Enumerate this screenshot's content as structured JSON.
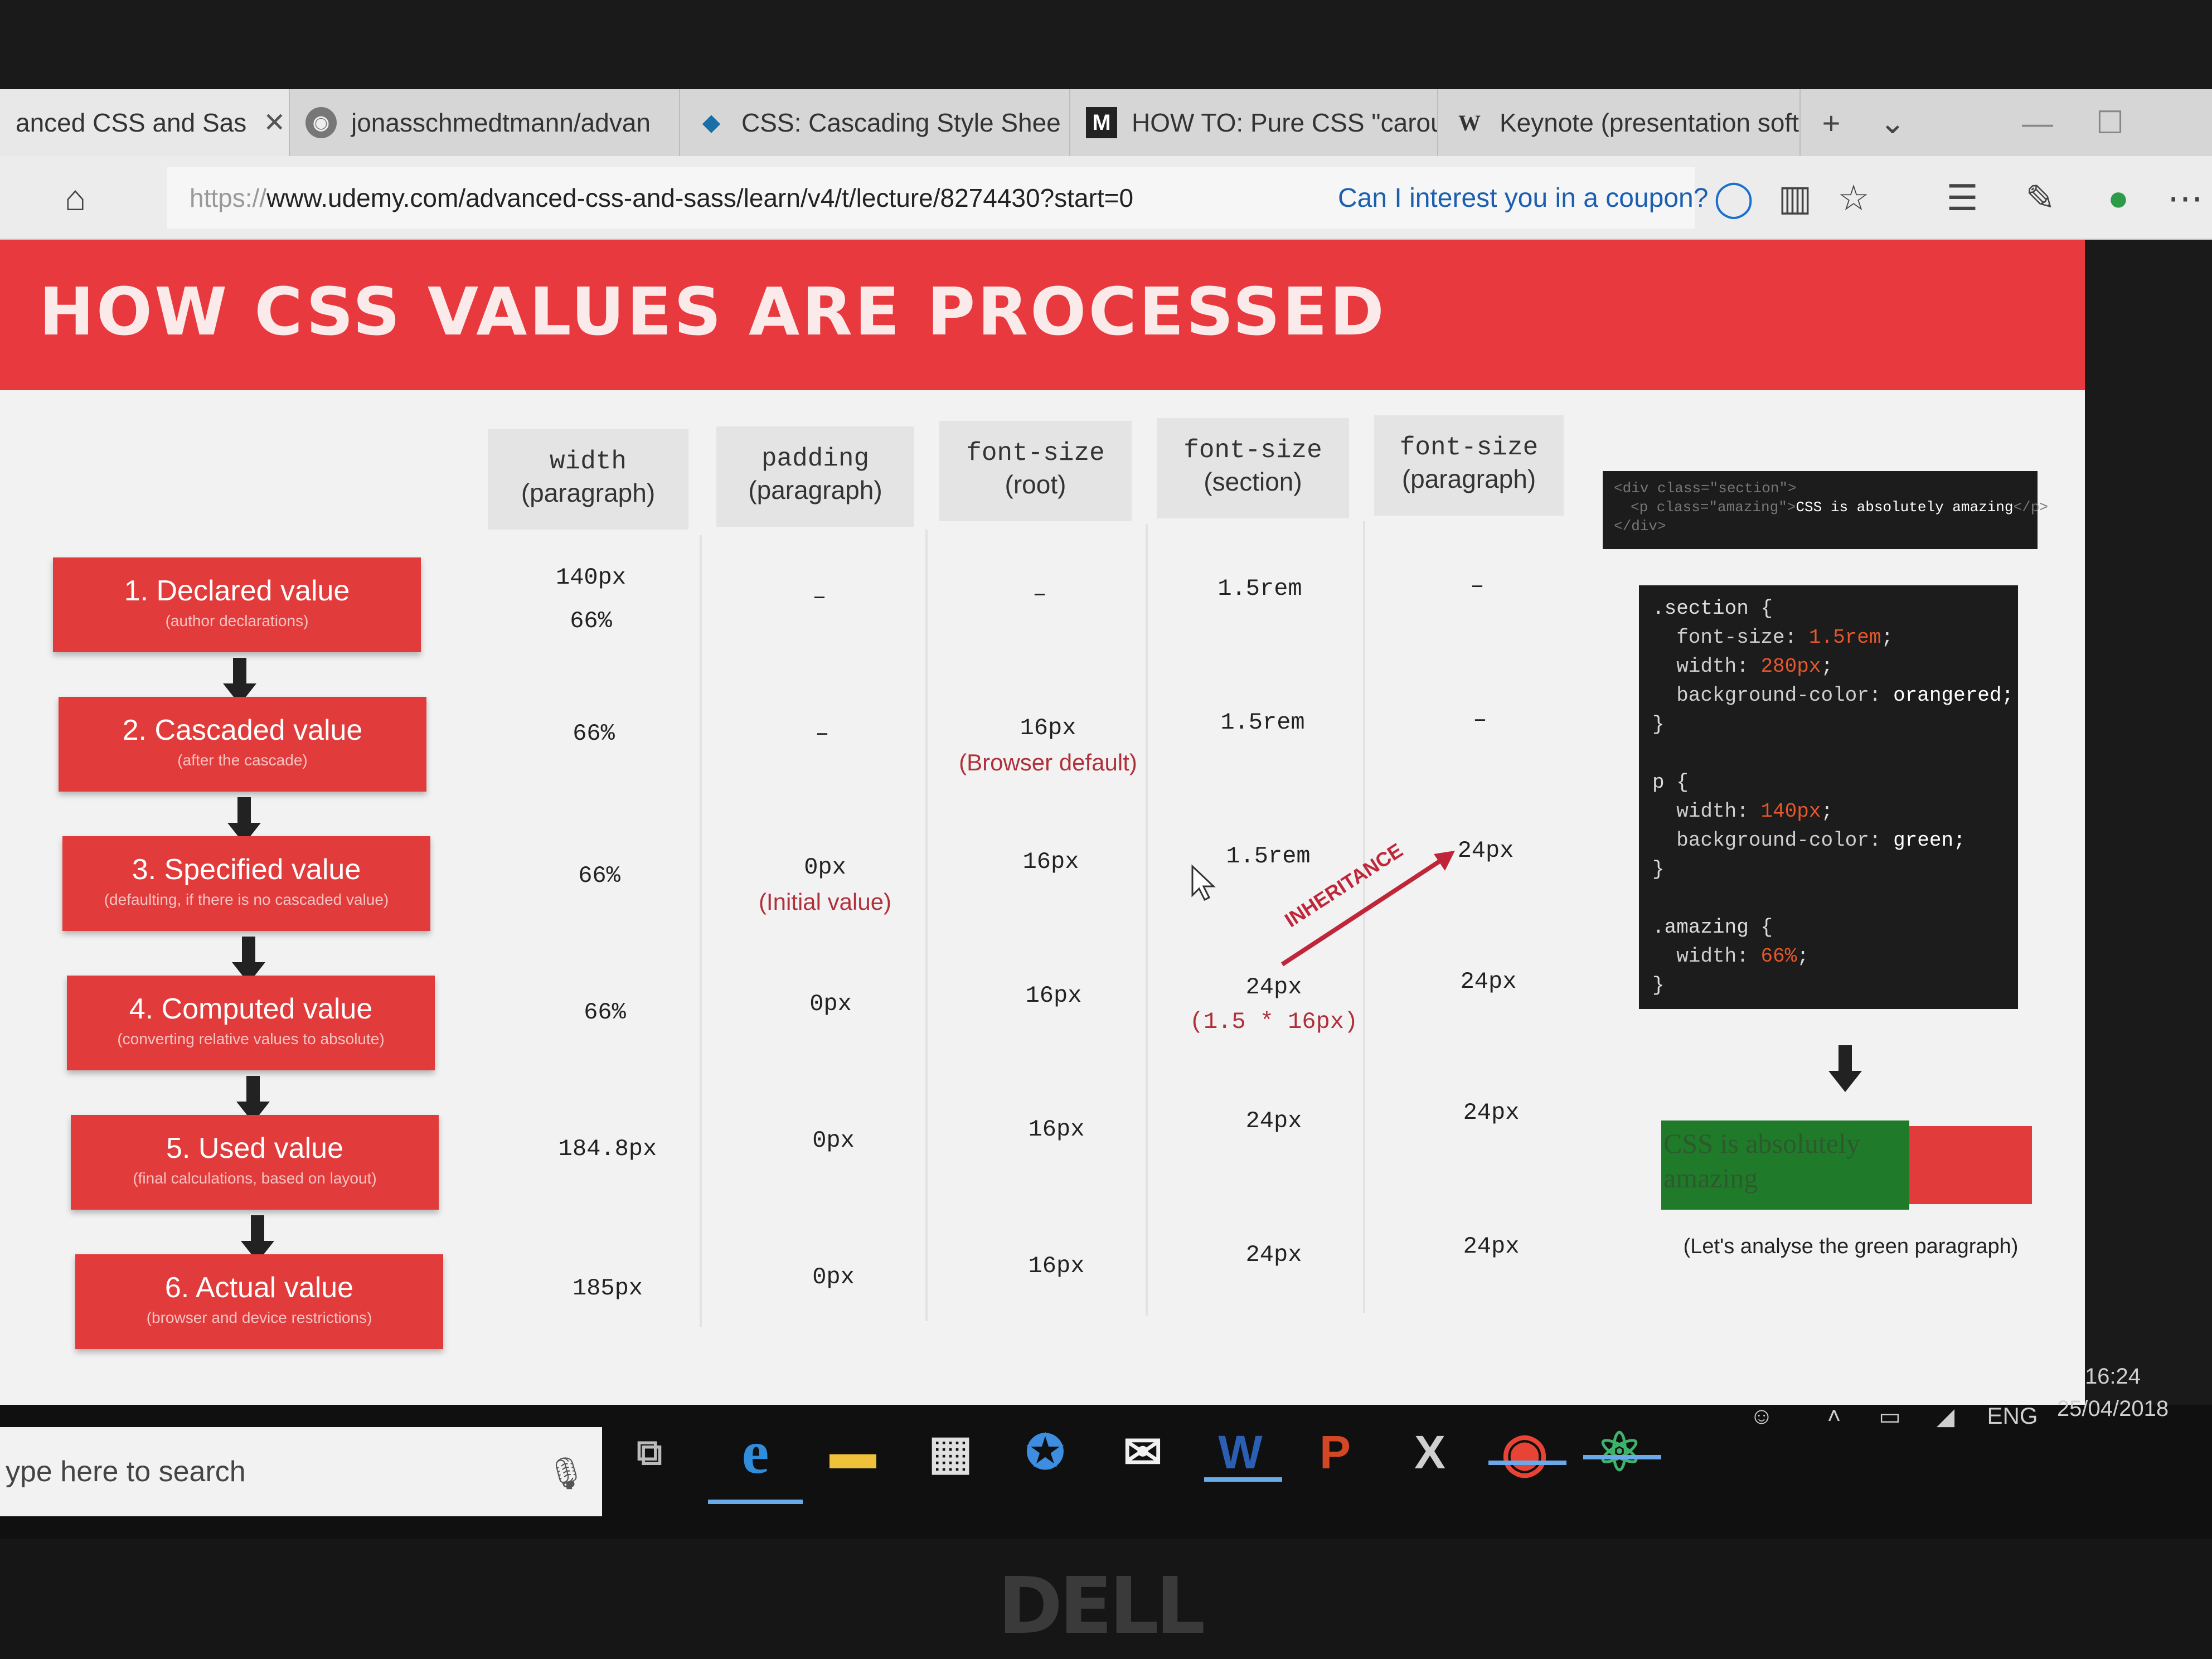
{
  "browser": {
    "tabs": [
      {
        "label": "anced CSS and Sas",
        "icon": "udemy-icon",
        "closable": true
      },
      {
        "label": "jonasschmedtmann/advan",
        "icon": "github-icon"
      },
      {
        "label": "CSS: Cascading Style Shee",
        "icon": "mdn-icon"
      },
      {
        "label": "HOW TO: Pure CSS \"carou",
        "icon": "medium-icon"
      },
      {
        "label": "Keynote (presentation soft",
        "icon": "wikipedia-icon"
      }
    ],
    "new_tab_glyph": "+",
    "tab_list_glyph": "⌄",
    "url_prefix": "https://",
    "url": "www.udemy.com/advanced-css-and-sass/learn/v4/t/lecture/8274430?start=0",
    "coupon_text": "Can I interest you in a coupon?"
  },
  "slide": {
    "title": "HOW CSS VALUES ARE PROCESSED",
    "columns": [
      {
        "prop": "width",
        "scope": "(paragraph)"
      },
      {
        "prop": "padding",
        "scope": "(paragraph)"
      },
      {
        "prop": "font-size",
        "scope": "(root)"
      },
      {
        "prop": "font-size",
        "scope": "(section)"
      },
      {
        "prop": "font-size",
        "scope": "(paragraph)"
      }
    ],
    "stages": [
      {
        "title": "1. Declared value",
        "subtitle": "(author declarations)"
      },
      {
        "title": "2. Cascaded value",
        "subtitle": "(after the cascade)"
      },
      {
        "title": "3. Specified value",
        "subtitle": "(defaulting, if there is no cascaded value)"
      },
      {
        "title": "4. Computed value",
        "subtitle": "(converting relative values to absolute)"
      },
      {
        "title": "5. Used value",
        "subtitle": "(final calculations, based on layout)"
      },
      {
        "title": "6. Actual value",
        "subtitle": "(browser and device restrictions)"
      }
    ],
    "rows": [
      [
        {
          "v": "140px",
          "v2": "66%"
        },
        {
          "v": "–"
        },
        {
          "v": "–"
        },
        {
          "v": "1.5rem"
        },
        {
          "v": "–"
        }
      ],
      [
        {
          "v": "66%"
        },
        {
          "v": "–"
        },
        {
          "v": "16px",
          "note": "(Browser default)"
        },
        {
          "v": "1.5rem"
        },
        {
          "v": "–"
        }
      ],
      [
        {
          "v": "66%"
        },
        {
          "v": "0px",
          "note": "(Initial value)"
        },
        {
          "v": "16px"
        },
        {
          "v": "1.5rem"
        },
        {
          "v": "24px"
        }
      ],
      [
        {
          "v": "66%"
        },
        {
          "v": "0px"
        },
        {
          "v": "16px"
        },
        {
          "v": "24px",
          "noteMono": "(1.5 * 16px)"
        },
        {
          "v": "24px"
        }
      ],
      [
        {
          "v": "184.8px"
        },
        {
          "v": "0px"
        },
        {
          "v": "16px"
        },
        {
          "v": "24px"
        },
        {
          "v": "24px"
        }
      ],
      [
        {
          "v": "185px"
        },
        {
          "v": "0px"
        },
        {
          "v": "16px"
        },
        {
          "v": "24px"
        },
        {
          "v": "24px"
        }
      ]
    ],
    "inheritance_label": "INHERITANCE",
    "html_snippet": {
      "line1": "<div class=\"section\">",
      "line2_prefix": "<p class=\"amazing\">",
      "line2_text": "CSS is absolutely amazing",
      "line2_suffix": "</p>",
      "line3": "</div>"
    },
    "css_snippet": {
      "section_selector": ".section {",
      "section_fs_prop": "  font-size: ",
      "section_fs_val": "1.5rem",
      "section_w_prop": "  width: ",
      "section_w_val": "280px",
      "section_bg_prop": "  background-color: ",
      "section_bg_val": "orangered;",
      "close": "}",
      "p_selector": "p {",
      "p_w_prop": "  width: ",
      "p_w_val": "140px",
      "p_bg_prop": "  background-color: ",
      "p_bg_val": "green;",
      "amazing_selector": ".amazing {",
      "amazing_w_prop": "  width: ",
      "amazing_w_val": "66%"
    },
    "result_text": "CSS is absolutely amazing",
    "caption": "(Let's analyse the green paragraph)",
    "colors": {
      "accent": "#e8393f",
      "green": "#1f7a2a",
      "orangered": "#e23b3b"
    }
  },
  "taskbar": {
    "search_placeholder": "ype here to search",
    "apps": [
      "task-view-icon",
      "edge-icon",
      "file-explorer-icon",
      "store-icon",
      "app-icon",
      "mail-icon",
      "word-icon",
      "powerpoint-icon",
      "excel-icon",
      "chrome-icon",
      "atom-icon"
    ],
    "language": "ENG",
    "time": "16:24",
    "date": "25/04/2018"
  },
  "device": {
    "brand": "DELL"
  }
}
